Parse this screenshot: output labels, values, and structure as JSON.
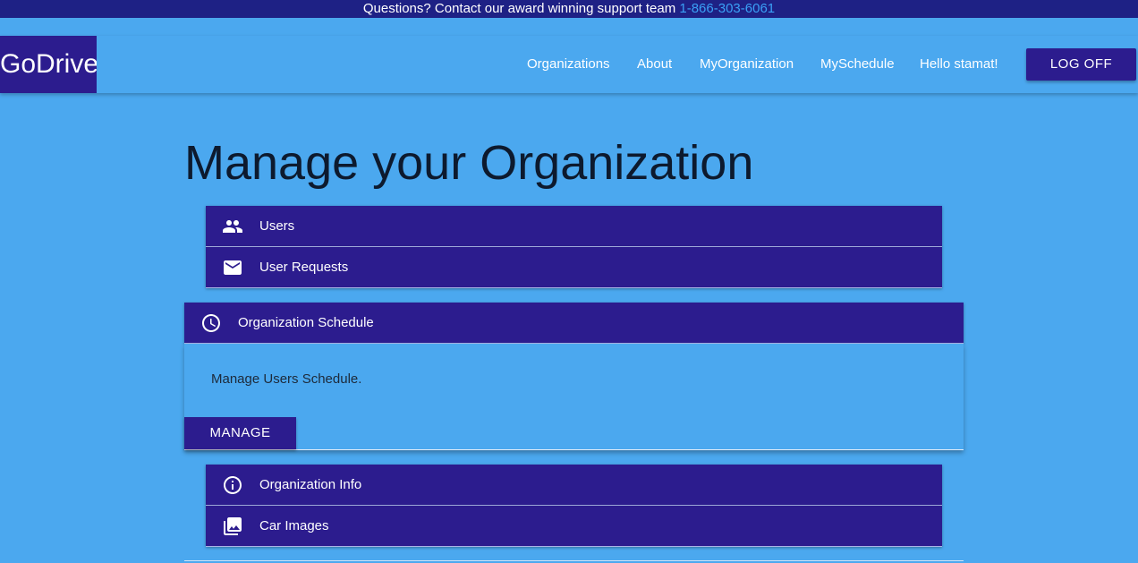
{
  "topbar": {
    "text": "Questions? Contact our award winning support team ",
    "phone": "1-866-303-6061"
  },
  "header": {
    "logo": "GoDrive",
    "nav": {
      "organizations": "Organizations",
      "about": "About",
      "my_organization": "MyOrganization",
      "my_schedule": "MySchedule",
      "greeting": "Hello stamat!"
    },
    "logoff": "LOG OFF"
  },
  "main": {
    "title": "Manage your Organization",
    "panels": [
      {
        "label": "Users",
        "icon": "people-icon"
      },
      {
        "label": "User Requests",
        "icon": "mail-icon"
      },
      {
        "label": "Organization Schedule",
        "icon": "clock-icon",
        "expanded": true,
        "description": "Manage Users Schedule.",
        "button": "MANAGE"
      },
      {
        "label": "Organization Info",
        "icon": "info-icon"
      },
      {
        "label": "Car Images",
        "icon": "photo-library-icon"
      }
    ]
  },
  "colors": {
    "page_background": "#4ba8ef",
    "topbar_background": "#1e2185",
    "accent": "#2c1c8e",
    "phone_link": "#3aa0f6",
    "title_text": "#0d1a2e"
  }
}
